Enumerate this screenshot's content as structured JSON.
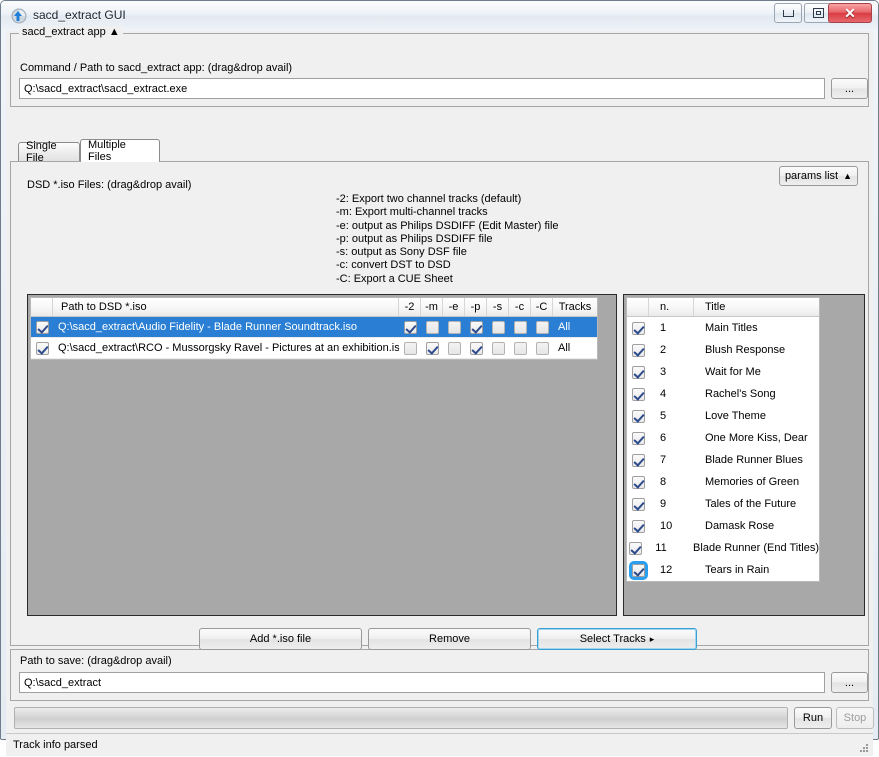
{
  "window": {
    "title": "sacd_extract GUI",
    "icon": "app-icon",
    "buttons": {
      "minimize": "minimize-icon",
      "maximize": "maximize-icon",
      "close": "✕"
    }
  },
  "app_group": {
    "title": "sacd_extract app ▲",
    "command_label": "Command / Path to sacd_extract app: (drag&drop avail)",
    "command_value": "Q:\\sacd_extract\\sacd_extract.exe",
    "browse_label": "..."
  },
  "tabs": [
    {
      "label": "Single File",
      "active": false
    },
    {
      "label": "Multiple Files",
      "active": true
    }
  ],
  "page": {
    "files_label": "DSD *.iso Files: (drag&drop avail)",
    "params_button": "params list",
    "params_arrow": "▲",
    "params_help": "-2: Export two channel tracks (default)\n-m: Export multi-channel tracks\n-e: output as Philips DSDIFF (Edit Master) file\n-p: output as Philips DSDIFF file\n-s: output as Sony DSF file\n-c: convert DST to DSD\n-C: Export a CUE Sheet"
  },
  "files_grid": {
    "headers": {
      "check": "",
      "path": "Path to DSD *.iso",
      "options": [
        "-2",
        "-m",
        "-e",
        "-p",
        "-s",
        "-c",
        "-C"
      ],
      "tracks": "Tracks"
    },
    "rows": [
      {
        "checked": true,
        "selected": true,
        "path": "Q:\\sacd_extract\\Audio Fidelity - Blade Runner Soundtrack.iso",
        "options": [
          true,
          false,
          false,
          true,
          false,
          false,
          false
        ],
        "tracks": "All"
      },
      {
        "checked": true,
        "selected": false,
        "path": "Q:\\sacd_extract\\RCO - Mussorgsky Ravel - Pictures at an exhibition.iso",
        "options": [
          false,
          true,
          false,
          true,
          false,
          false,
          false
        ],
        "tracks": "All"
      }
    ]
  },
  "tracks_grid": {
    "headers": {
      "check": "",
      "number": "n.",
      "title": "Title"
    },
    "rows": [
      {
        "checked": true,
        "n": "1",
        "title": "Main Titles",
        "focused": false
      },
      {
        "checked": true,
        "n": "2",
        "title": "Blush Response",
        "focused": false
      },
      {
        "checked": true,
        "n": "3",
        "title": "Wait for Me",
        "focused": false
      },
      {
        "checked": true,
        "n": "4",
        "title": "Rachel's Song",
        "focused": false
      },
      {
        "checked": true,
        "n": "5",
        "title": "Love Theme",
        "focused": false
      },
      {
        "checked": true,
        "n": "6",
        "title": "One More Kiss, Dear",
        "focused": false
      },
      {
        "checked": true,
        "n": "7",
        "title": "Blade Runner Blues",
        "focused": false
      },
      {
        "checked": true,
        "n": "8",
        "title": "Memories of Green",
        "focused": false
      },
      {
        "checked": true,
        "n": "9",
        "title": "Tales of the Future",
        "focused": false
      },
      {
        "checked": true,
        "n": "10",
        "title": "Damask Rose",
        "focused": false
      },
      {
        "checked": true,
        "n": "11",
        "title": "Blade Runner (End Titles)",
        "focused": false
      },
      {
        "checked": true,
        "n": "12",
        "title": "Tears in Rain",
        "focused": true
      }
    ]
  },
  "actions": {
    "add_label": "Add *.iso file",
    "remove_label": "Remove",
    "select_tracks_label": "Select Tracks",
    "select_tracks_arrow": "▸"
  },
  "save_group": {
    "label": "Path to save: (drag&drop avail)",
    "value": "Q:\\sacd_extract",
    "browse_label": "..."
  },
  "run_row": {
    "progress_value": 0,
    "run_label": "Run",
    "stop_label": "Stop",
    "stop_disabled": true
  },
  "status": {
    "text": "Track info parsed"
  },
  "colors": {
    "selection_blue": "#2a7fd4",
    "focus_blue": "#2a9ff0",
    "window_bg": "#f0f0f0",
    "panel_gray": "#a8a8a8",
    "close_red": "#d93c42"
  }
}
